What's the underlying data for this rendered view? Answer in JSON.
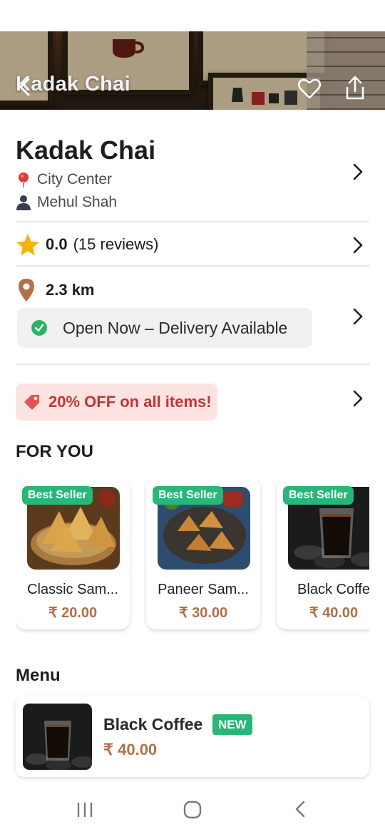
{
  "header": {
    "title": "Kadak Chai"
  },
  "restaurant": {
    "name": "Kadak Chai",
    "location": "City Center",
    "owner": "Mehul Shah",
    "rating_value": "0.0",
    "rating_reviews": "(15 reviews)",
    "distance": "2.3 km",
    "status": "Open Now – Delivery Available"
  },
  "offer": {
    "text": "20% OFF on all items!"
  },
  "for_you": {
    "title": "FOR YOU",
    "items": [
      {
        "badge": "Best Seller",
        "name": "Classic Sam...",
        "price": "₹ 20.00"
      },
      {
        "badge": "Best Seller",
        "name": "Paneer Sam...",
        "price": "₹ 30.00"
      },
      {
        "badge": "Best Seller",
        "name": "Black Coffe",
        "price": "₹ 40.00"
      }
    ]
  },
  "menu": {
    "title": "Menu",
    "items": [
      {
        "name": "Black Coffee",
        "badge": "NEW",
        "price": "₹ 40.00"
      }
    ]
  },
  "colors": {
    "accent": "#28b779",
    "price": "#b07148",
    "offer_text": "#c13534",
    "offer_bg": "#fde3e2",
    "star": "#f4b400"
  }
}
